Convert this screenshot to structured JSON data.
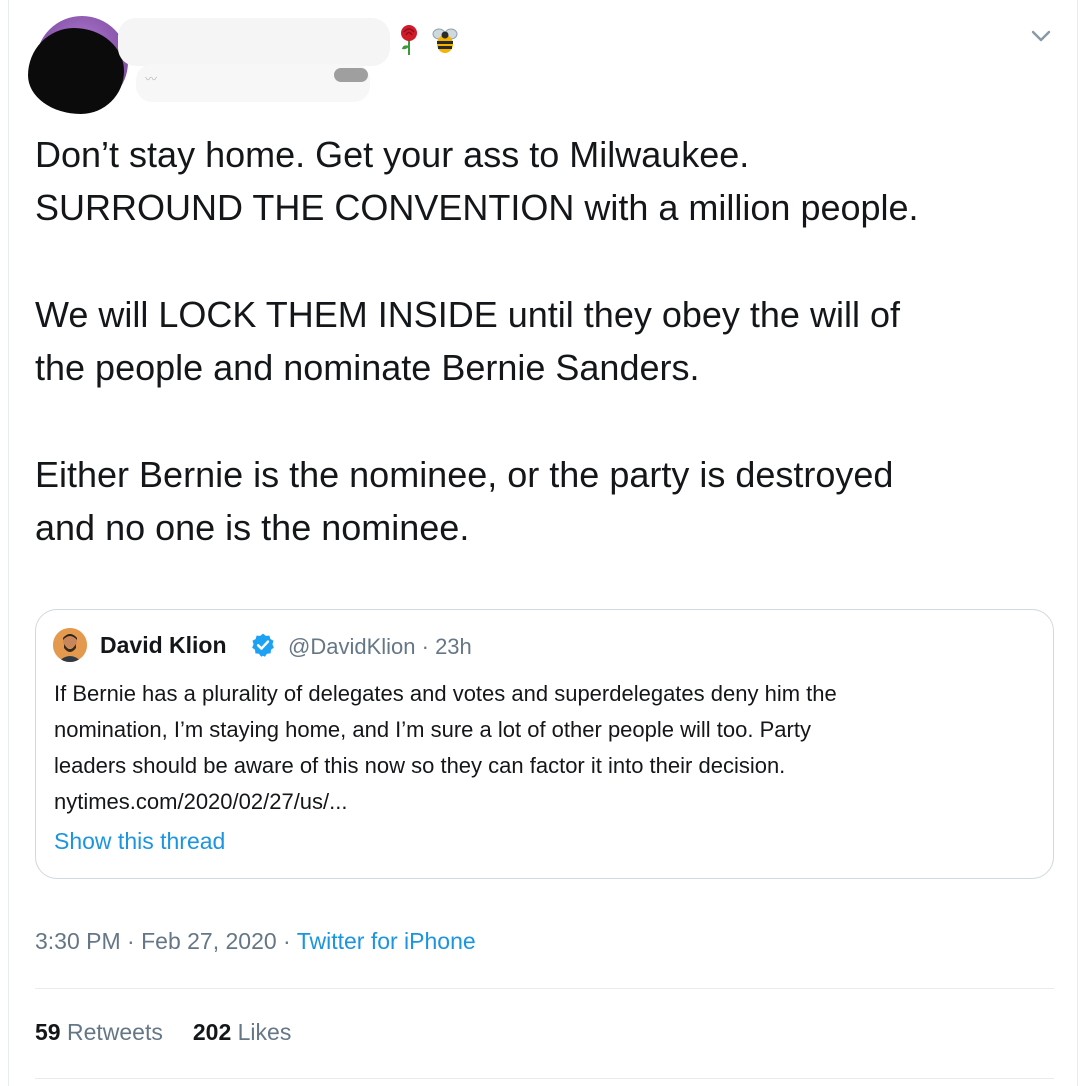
{
  "tweet": {
    "paragraphs": [
      [
        "Don’t stay home. Get your ass to Milwaukee.",
        "SURROUND THE CONVENTION with a million people."
      ],
      [
        "We will LOCK THEM INSIDE until they obey the will of",
        "the people and nominate Bernie Sanders."
      ],
      [
        "Either Bernie is the nominee, or the party is destroyed",
        "and no one is the nominee."
      ]
    ],
    "author_emojis": [
      "rose-icon",
      "bee-icon"
    ],
    "more_menu_icon": "chevron-down-icon"
  },
  "quote": {
    "author_name": "David Klion",
    "verified": true,
    "handle": "@DavidKlion",
    "meta_sep": " · ",
    "time_ago": "23h",
    "body_lines": [
      "If Bernie has a plurality of delegates and votes and superdelegates deny him the",
      "nomination, I’m staying home, and I’m sure a lot of other people will too. Party",
      "leaders should be aware of this now so they can factor it into their decision.",
      "nytimes.com/2020/02/27/us/..."
    ],
    "show_thread": "Show this thread"
  },
  "footer": {
    "time": "3:30 PM",
    "sep": " · ",
    "date": "Feb 27, 2020",
    "source": "Twitter for iPhone",
    "retweets_count": "59",
    "retweets_label": "Retweets",
    "likes_count": "202",
    "likes_label": "Likes"
  },
  "colors": {
    "text": "#14171a",
    "secondary": "#657786",
    "link": "#1b95e0",
    "verified": "#1da1f2",
    "border": "#cfd9de"
  }
}
